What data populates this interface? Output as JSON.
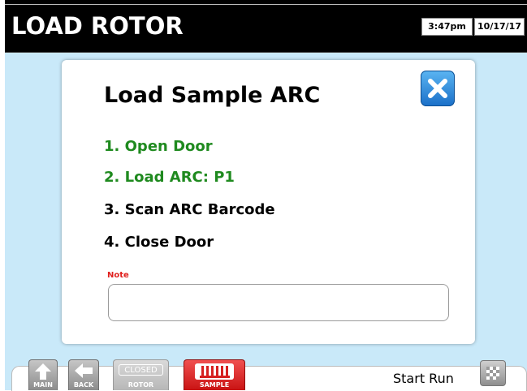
{
  "header": {
    "title": "LOAD ROTOR",
    "time": "3:47pm",
    "date": "10/17/17"
  },
  "dialog": {
    "title": "Load Sample ARC",
    "close_icon": "close-x-icon",
    "steps": [
      {
        "label": "1. Open Door",
        "status": "done"
      },
      {
        "label": "2. Load ARC: P1",
        "status": "done"
      },
      {
        "label": "3. Scan ARC Barcode",
        "status": "pending"
      },
      {
        "label": "4. Close Door",
        "status": "pending"
      }
    ],
    "note": {
      "label": "Note",
      "value": "",
      "placeholder": ""
    }
  },
  "footer": {
    "buttons": [
      {
        "label": "MAIN",
        "icon": "up-arrow-icon"
      },
      {
        "label": "BACK",
        "icon": "left-arrow-icon"
      },
      {
        "label": "ROTOR",
        "top_label": "CLOSED"
      },
      {
        "label": "SAMPLE",
        "icon": "sample-rack-icon"
      }
    ],
    "start_run": "Start Run",
    "start_icon": "checkered-flag-icon"
  },
  "colors": {
    "background": "#c9e9f9",
    "header": "#000000",
    "done_step": "#1f8a1f",
    "pending_step": "#000000",
    "note_label": "#e0201e",
    "close_button": "#2a86dc",
    "sample_button": "#d62020"
  }
}
